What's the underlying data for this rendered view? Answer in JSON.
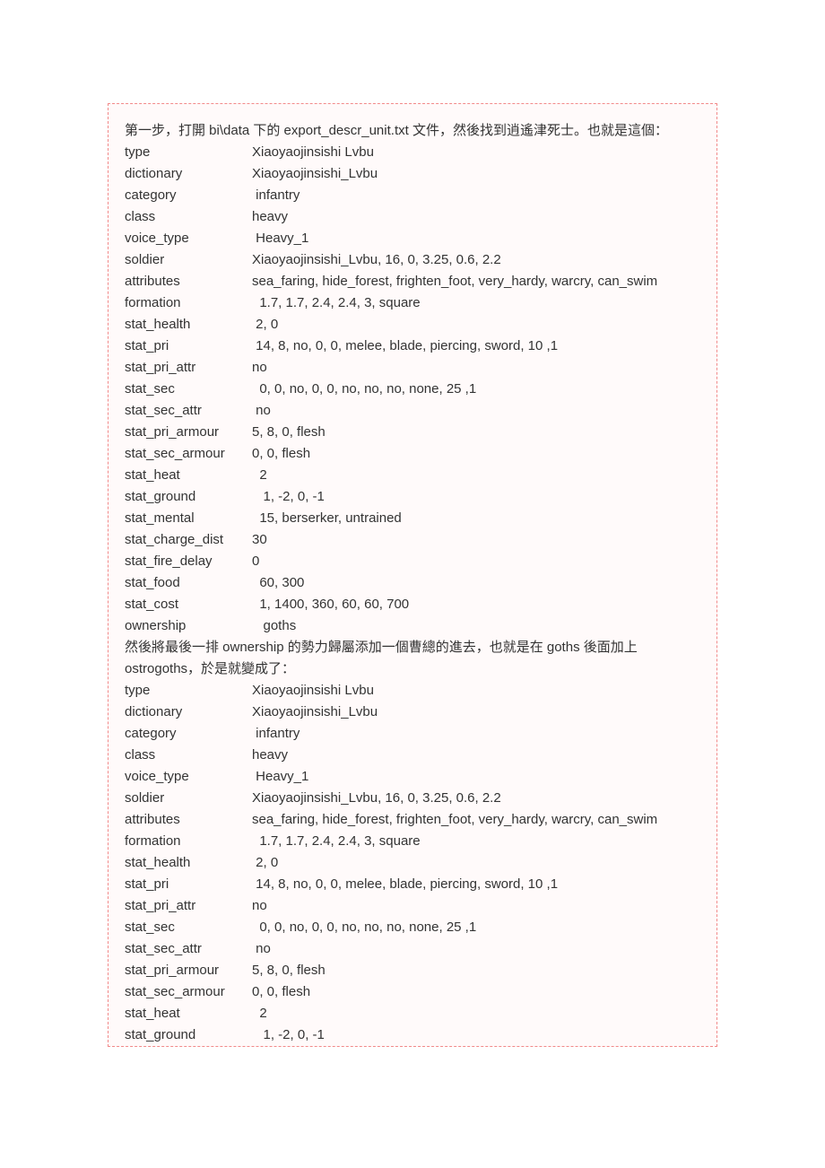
{
  "intro": "第一步，打開 bi\\data 下的 export_descr_unit.txt 文件，然後找到逍遙津死士。也就是這個：",
  "block1": [
    {
      "k": "type",
      "v": "Xiaoyaojinsishi Lvbu"
    },
    {
      "k": "dictionary",
      "v": "Xiaoyaojinsishi_Lvbu"
    },
    {
      "k": "category",
      "v": " infantry"
    },
    {
      "k": "class",
      "v": "heavy"
    },
    {
      "k": "voice_type",
      "v": " Heavy_1"
    },
    {
      "k": "soldier",
      "v": "Xiaoyaojinsishi_Lvbu, 16, 0, 3.25, 0.6, 2.2"
    },
    {
      "k": "attributes",
      "v": "sea_faring, hide_forest, frighten_foot, very_hardy, warcry, can_swim"
    },
    {
      "k": "formation",
      "v": "  1.7, 1.7, 2.4, 2.4, 3, square"
    },
    {
      "k": "stat_health",
      "v": " 2, 0"
    },
    {
      "k": "stat_pri",
      "v": " 14, 8, no, 0, 0, melee, blade, piercing, sword, 10 ,1"
    },
    {
      "k": "stat_pri_attr",
      "v": "no"
    },
    {
      "k": "stat_sec",
      "v": "  0, 0, no, 0, 0, no, no, no, none, 25 ,1"
    },
    {
      "k": "stat_sec_attr",
      "v": " no"
    },
    {
      "k": "stat_pri_armour",
      "v": "5, 8, 0, flesh"
    },
    {
      "k": "stat_sec_armour",
      "v": "0, 0, flesh"
    },
    {
      "k": "stat_heat",
      "v": "  2"
    },
    {
      "k": "stat_ground",
      "v": "   1, -2, 0, -1"
    },
    {
      "k": "stat_mental",
      "v": "  15, berserker, untrained"
    },
    {
      "k": "stat_charge_dist",
      "v": "30"
    },
    {
      "k": "stat_fire_delay",
      "v": "0"
    },
    {
      "k": "stat_food",
      "v": "  60, 300"
    },
    {
      "k": "stat_cost",
      "v": "  1, 1400, 360, 60, 60, 700"
    },
    {
      "k": "ownership",
      "v": "   goths"
    }
  ],
  "mid1": "然後將最後一排 ownership 的勢力歸屬添加一個曹總的進去，也就是在 goths 後面加上",
  "mid2": "ostrogoths，於是就變成了：",
  "block2": [
    {
      "k": "type",
      "v": "Xiaoyaojinsishi Lvbu"
    },
    {
      "k": "dictionary",
      "v": "Xiaoyaojinsishi_Lvbu"
    },
    {
      "k": "category",
      "v": " infantry"
    },
    {
      "k": "class",
      "v": "heavy"
    },
    {
      "k": "voice_type",
      "v": " Heavy_1"
    },
    {
      "k": "soldier",
      "v": "Xiaoyaojinsishi_Lvbu, 16, 0, 3.25, 0.6, 2.2"
    },
    {
      "k": "attributes",
      "v": "sea_faring, hide_forest, frighten_foot, very_hardy, warcry, can_swim"
    },
    {
      "k": "formation",
      "v": "  1.7, 1.7, 2.4, 2.4, 3, square"
    },
    {
      "k": "stat_health",
      "v": " 2, 0"
    },
    {
      "k": "stat_pri",
      "v": " 14, 8, no, 0, 0, melee, blade, piercing, sword, 10 ,1"
    },
    {
      "k": "stat_pri_attr",
      "v": "no"
    },
    {
      "k": "stat_sec",
      "v": "  0, 0, no, 0, 0, no, no, no, none, 25 ,1"
    },
    {
      "k": "stat_sec_attr",
      "v": " no"
    },
    {
      "k": "stat_pri_armour",
      "v": "5, 8, 0, flesh"
    },
    {
      "k": "stat_sec_armour",
      "v": "0, 0, flesh"
    },
    {
      "k": "stat_heat",
      "v": "  2"
    },
    {
      "k": "stat_ground",
      "v": "   1, -2, 0, -1"
    }
  ]
}
